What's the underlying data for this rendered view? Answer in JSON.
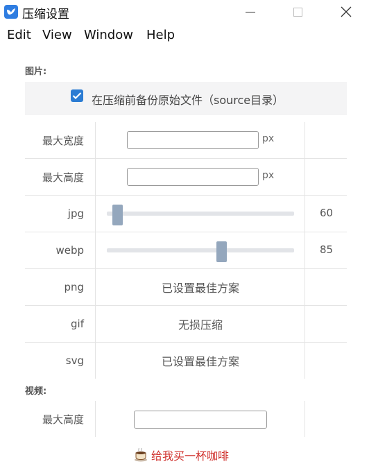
{
  "window": {
    "title": "压缩设置",
    "app_icon": "bird-app-icon",
    "controls": [
      "minimize-icon",
      "maximize-icon",
      "close-icon"
    ]
  },
  "menu": [
    "Edit",
    "View",
    "Window",
    "Help"
  ],
  "image_section": {
    "label": "图片:",
    "backup": {
      "checked": true,
      "label": "在压缩前备份原始文件（source目录）"
    },
    "max_width": {
      "label": "最大宽度",
      "value": "",
      "unit": "px"
    },
    "max_height": {
      "label": "最大高度",
      "value": "",
      "unit": "px"
    },
    "jpg": {
      "label": "jpg",
      "value": "60",
      "percent": 0.03
    },
    "webp": {
      "label": "webp",
      "value": "85",
      "percent": 0.62
    },
    "png": {
      "label": "png",
      "text": "已设置最佳方案"
    },
    "gif": {
      "label": "gif",
      "text": "无损压缩"
    },
    "svg": {
      "label": "svg",
      "text": "已设置最佳方案"
    }
  },
  "video_section": {
    "label": "视频:",
    "max_height": {
      "label": "最大高度",
      "value": ""
    }
  },
  "coffee": {
    "icon": "coffee-cup-icon",
    "label": "给我买一杯咖啡"
  },
  "colors": {
    "accent": "#2b7cd3",
    "link": "#d0312d",
    "thumb": "#94a7bd"
  }
}
